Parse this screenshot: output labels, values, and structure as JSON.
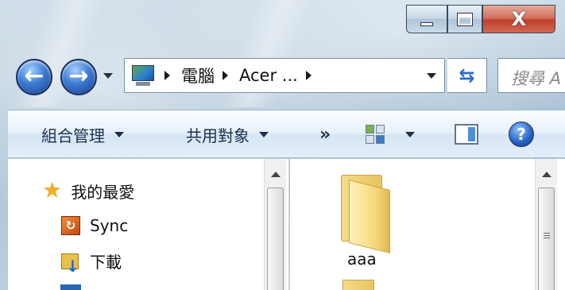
{
  "window": {
    "caption": {
      "minimize_icon": "minimize-icon",
      "maximize_icon": "maximize-icon",
      "close_glyph": "X"
    }
  },
  "navigation": {
    "back_glyph": "←",
    "forward_glyph": "→",
    "address": {
      "crumbs": [
        "電腦",
        "Acer ..."
      ]
    },
    "refresh_glyph": "⇆",
    "search_placeholder": "搜尋 A"
  },
  "command_bar": {
    "organize_label": "組合管理",
    "share_label": "共用對象",
    "more_glyph": "»",
    "help_glyph": "?"
  },
  "nav_pane": {
    "items": [
      {
        "label": "我的最愛",
        "icon": "star-icon"
      },
      {
        "label": "Sync",
        "icon": "sync-icon"
      },
      {
        "label": "下載",
        "icon": "downloads-folder-icon"
      }
    ]
  },
  "content": {
    "items": [
      {
        "label": "aaa",
        "icon": "folder-icon"
      }
    ]
  },
  "colors": {
    "accent": "#2c6bc7",
    "close_button": "#c0402c",
    "folder": "#f3d677"
  }
}
